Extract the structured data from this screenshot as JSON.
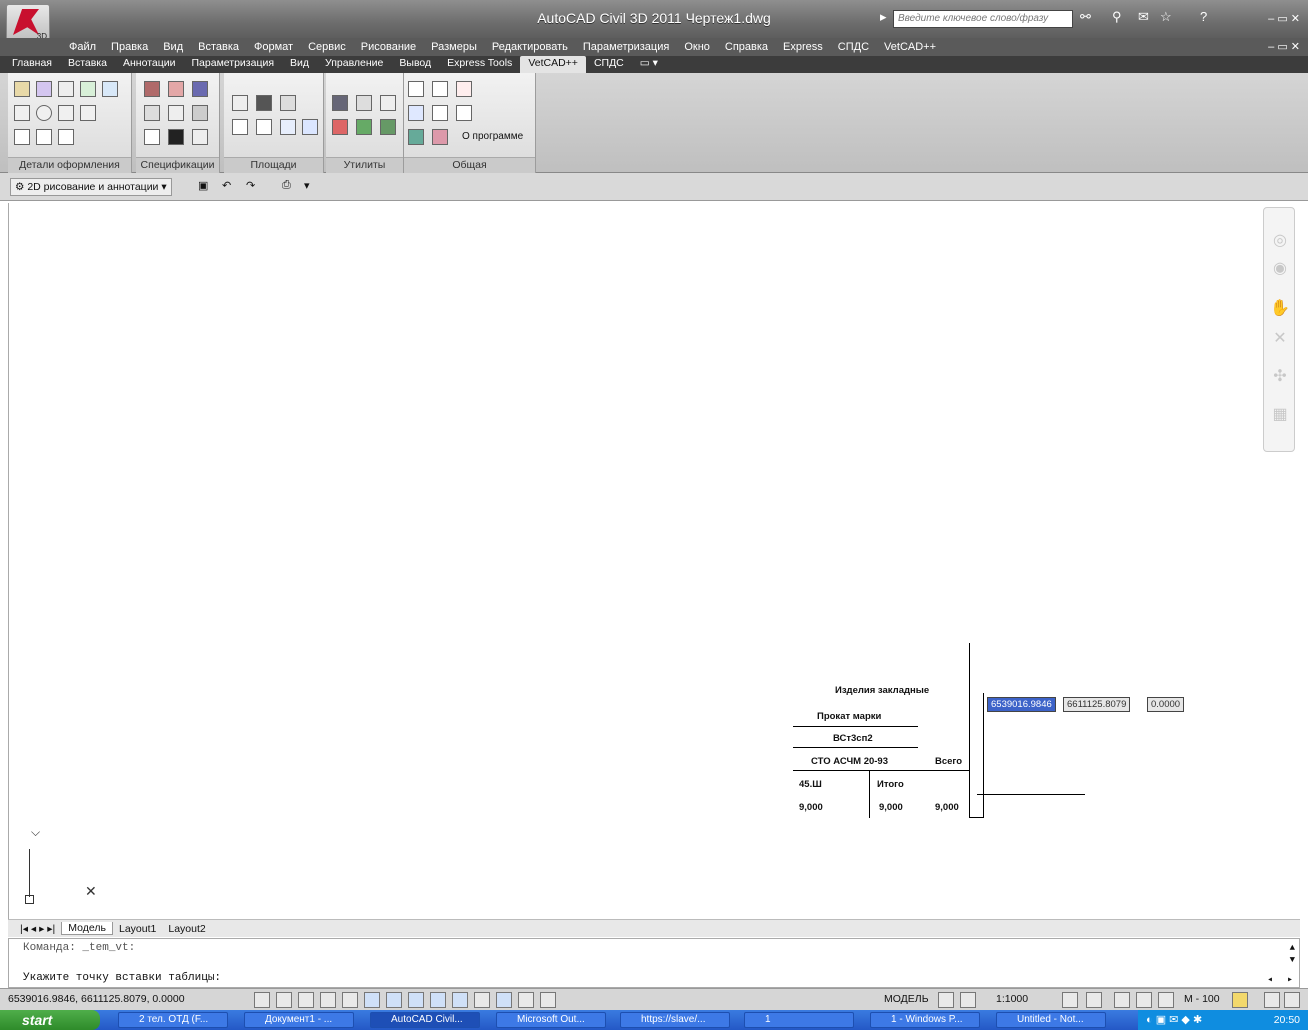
{
  "window": {
    "title": "AutoCAD Civil 3D 2011    Чертеж1.dwg",
    "app_version_badge": "3D",
    "search_placeholder": "Введите ключевое слово/фразу",
    "colors": {
      "titlebar": "#6d6d6d",
      "ribbon_tabs_bg": "#3c3c3c",
      "taskbar": "#2458c6",
      "app_logo": "#c8102e"
    }
  },
  "menu": {
    "items": [
      "Файл",
      "Правка",
      "Вид",
      "Вставка",
      "Формат",
      "Сервис",
      "Рисование",
      "Размеры",
      "Редактировать",
      "Параметризация",
      "Окно",
      "Справка",
      "Express",
      "СПДС",
      "VetCAD++"
    ]
  },
  "ribbon": {
    "tabs": [
      "Главная",
      "Вставка",
      "Аннотации",
      "Параметризация",
      "Вид",
      "Управление",
      "Вывод",
      "Express Tools",
      "VetCAD++",
      "СПДС"
    ],
    "active_tab": "VetCAD++",
    "panels": [
      {
        "title": "Детали оформления"
      },
      {
        "title": "Спецификации"
      },
      {
        "title": "Площади"
      },
      {
        "title": "Утилиты"
      },
      {
        "title": "Общая",
        "about_label": "О программе"
      }
    ]
  },
  "quick_access": {
    "workspace": "2D рисование и аннотации"
  },
  "drawing": {
    "table_header": "Изделия закладные",
    "col_header": "Прокат марки",
    "grade": "ВСт3сп2",
    "standard": "СТО АСЧМ 20-93",
    "total_label": "Всего",
    "profile": "45.Ш",
    "mass_label": "Итого",
    "row_values": [
      "9,000",
      "9,000",
      "9,000"
    ],
    "coords": [
      "6539016.9846",
      "6611125.8079",
      "0.0000"
    ]
  },
  "layout_tabs": [
    "Модель",
    "Layout1",
    "Layout2"
  ],
  "command": {
    "history": "Команда: _tem_vt:",
    "prompt": "Укажите точку вставки таблицы:"
  },
  "status": {
    "coordinates": "6539016.9846, 6611125.8079, 0.0000",
    "mode": "МОДЕЛЬ",
    "scale": "1:1000",
    "annotation": "М - 100"
  },
  "taskbar": {
    "start_label": "start",
    "tasks": [
      "2 тел. ОТД (F...",
      "Документ1 - ...",
      "AutoCAD Civil...",
      "Microsoft Out...",
      "https://slave/...",
      "1",
      "1 - Windows P...",
      "Untitled - Not..."
    ],
    "active_task": 2,
    "clock": "20:50"
  }
}
